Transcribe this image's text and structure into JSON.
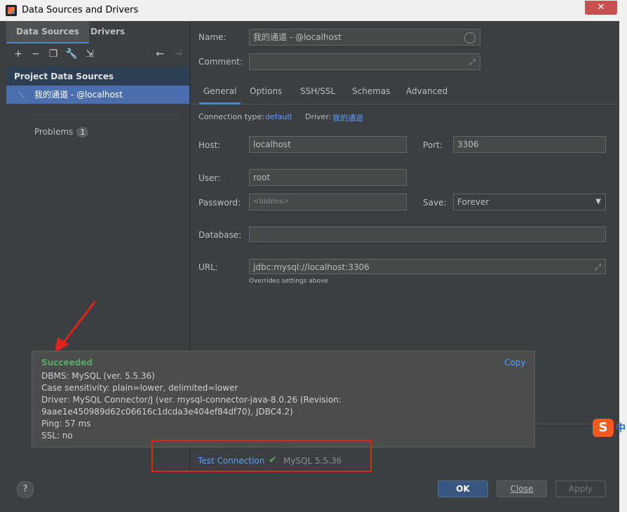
{
  "window": {
    "title": "Data Sources and Drivers",
    "close_glyph": "✕"
  },
  "left_panel": {
    "tabs": [
      "Data Sources",
      "Drivers"
    ],
    "toolbar_icons": [
      "add-icon",
      "remove-icon",
      "duplicate-icon",
      "wrench-icon",
      "import-icon",
      "back-icon",
      "forward-icon"
    ],
    "section_header": "Project Data Sources",
    "data_source": "我的通道 - @localhost",
    "problems_label": "Problems",
    "problems_count": "1"
  },
  "form": {
    "name_label": "Name:",
    "name_value": "我的通道 - @localhost",
    "comment_label": "Comment:",
    "comment_value": "",
    "tabs": [
      "General",
      "Options",
      "SSH/SSL",
      "Schemas",
      "Advanced"
    ],
    "connection_type_label": "Connection type:",
    "connection_type_value": "default",
    "driver_label": "Driver:",
    "driver_value": "我的通道",
    "host_label": "Host:",
    "host_value": "localhost",
    "port_label": "Port:",
    "port_value": "3306",
    "user_label": "User:",
    "user_value": "root",
    "password_label": "Password:",
    "password_value": "<hidden>",
    "save_label": "Save:",
    "save_value": "Forever",
    "database_label": "Database:",
    "database_value": "",
    "url_label": "URL:",
    "url_value": "jdbc:mysql://localhost:3306",
    "url_hint": "Overrides settings above"
  },
  "popup": {
    "status": "Succeeded",
    "copy_label": "Copy",
    "lines": [
      "DBMS: MySQL (ver. 5.5.36)",
      "Case sensitivity: plain=lower, delimited=lower",
      "Driver: MySQL Connector/J (ver. mysql-connector-java-8.0.26 (Revision:",
      "9aae1e450989d62c06616c1dcda3e404ef84df70), JDBC4.2)",
      "Ping: 57 ms",
      "SSL: no"
    ]
  },
  "test_connection": {
    "label": "Test Connection",
    "result": "MySQL 5.5.36"
  },
  "buttons": {
    "help": "?",
    "ok": "OK",
    "close": "Close",
    "apply": "Apply"
  },
  "ime": {
    "brand": "S",
    "mode": "中"
  },
  "colors": {
    "accent": "#4a88c7",
    "success": "#59a869",
    "link": "#589df6",
    "annotation": "#e0231b",
    "selection": "#4b6eaf"
  }
}
